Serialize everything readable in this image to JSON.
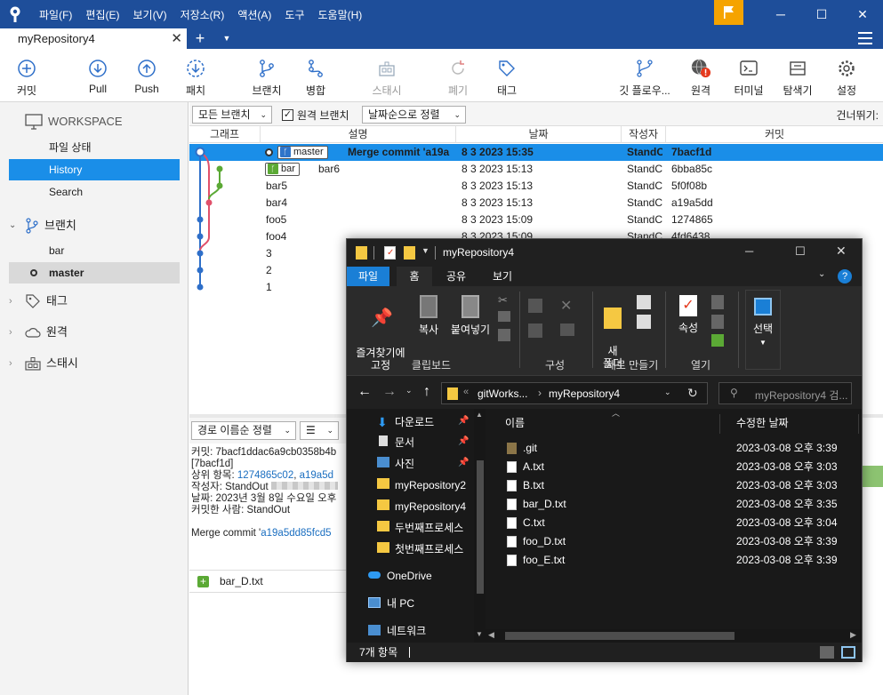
{
  "titlebar": {
    "menu": [
      "파일(F)",
      "편집(E)",
      "보기(V)",
      "저장소(R)",
      "액션(A)",
      "도구",
      "도움말(H)"
    ],
    "minimize": "─",
    "maximize": "☐",
    "close": "✕"
  },
  "tabbar": {
    "tab_title": "myRepository4",
    "close": "✕",
    "plus": "+",
    "dropdown": "▼"
  },
  "toolbar": {
    "commit": "커밋",
    "pull": "Pull",
    "push": "Push",
    "fetch": "패치",
    "branch": "브랜치",
    "merge": "병합",
    "stash": "스태시",
    "discard": "폐기",
    "tag": "태그",
    "gitflow": "깃 플로우...",
    "remote": "원격",
    "terminal": "터미널",
    "explorer": "탐색기",
    "settings": "설정"
  },
  "sidebar": {
    "workspace": "WORKSPACE",
    "file_status": "파일 상태",
    "history": "History",
    "search": "Search",
    "branches_header": "브랜치",
    "branch_bar": "bar",
    "branch_master": "master",
    "tags": "태그",
    "remotes": "원격",
    "stashes": "스태시"
  },
  "filterbar": {
    "all_branches": "모든 브랜치",
    "remote_branches": "원격 브랜치",
    "remote_checked": true,
    "sort": "날짜순으로 정렬",
    "skip": "건너뛰기:"
  },
  "columns": {
    "graph": "그래프",
    "description": "설명",
    "date": "날짜",
    "author": "작성자",
    "commit": "커밋"
  },
  "commits": [
    {
      "tag": "master",
      "desc": "Merge commit 'a19a",
      "date": "8 3 2023 15:35",
      "author": "StandC",
      "hash": "7bacf1d"
    },
    {
      "tag": "bar",
      "desc": "bar6",
      "date": "8 3 2023 15:13",
      "author": "StandC",
      "hash": "6bba85c"
    },
    {
      "tag": "",
      "desc": "bar5",
      "date": "8 3 2023 15:13",
      "author": "StandC",
      "hash": "5f0f08b"
    },
    {
      "tag": "",
      "desc": "bar4",
      "date": "8 3 2023 15:13",
      "author": "StandC",
      "hash": "a19a5dd"
    },
    {
      "tag": "",
      "desc": "foo5",
      "date": "8 3 2023 15:09",
      "author": "StandC",
      "hash": "1274865"
    },
    {
      "tag": "",
      "desc": "foo4",
      "date": "8 3 2023 15:09",
      "author": "StandC",
      "hash": "4fd6438"
    },
    {
      "tag": "",
      "desc": "3",
      "date": "",
      "author": "",
      "hash": ""
    },
    {
      "tag": "",
      "desc": "2",
      "date": "",
      "author": "",
      "hash": ""
    },
    {
      "tag": "",
      "desc": "1",
      "date": "",
      "author": "",
      "hash": ""
    }
  ],
  "lower": {
    "sort_paths": "경로 이름순 정렬",
    "view_menu": "☰",
    "commit_line": "커밋: 7bacf1ddac6a9cb0358b4b",
    "commit_short": "[7bacf1d]",
    "parents_label": "상위 항목: ",
    "parent1": "1274865c02",
    "parent_sep": ", ",
    "parent2": "a19a5d",
    "author_line": "작성자: StandOut",
    "date_line": "날짜: 2023년 3월 8일 수요일 오후",
    "committer_line": "커밋한 사람: StandOut",
    "message_prefix": "Merge commit '",
    "message_link": "a19a5dd85fcd5",
    "file": "bar_D.txt"
  },
  "explorer": {
    "title": "myRepository4",
    "tabs": [
      "파일",
      "홈",
      "공유",
      "보기"
    ],
    "ribbon": {
      "pin": "즐겨찾기에\n고정",
      "copy": "복사",
      "paste": "붙여넣기",
      "new_folder": "새\n폴더",
      "properties": "속성",
      "select": "선택",
      "group_clipboard": "클립보드",
      "group_organize": "구성",
      "group_new": "새로 만들기",
      "group_open": "열기"
    },
    "address": {
      "crumb1": "gitWorks...",
      "crumb2": "myRepository4",
      "search_placeholder": "myRepository4 검..."
    },
    "nav": [
      "다운로드",
      "문서",
      "사진",
      "myRepository2",
      "myRepository4",
      "두번째프로세스",
      "첫번째프로세스",
      "OneDrive",
      "내 PC",
      "네트워크"
    ],
    "columns": {
      "name": "이름",
      "modified": "수정한 날짜"
    },
    "files": [
      {
        "name": ".git",
        "date": "2023-03-08 오후 3:39",
        "type": "folder"
      },
      {
        "name": "A.txt",
        "date": "2023-03-08 오후 3:03",
        "type": "file"
      },
      {
        "name": "B.txt",
        "date": "2023-03-08 오후 3:03",
        "type": "file"
      },
      {
        "name": "bar_D.txt",
        "date": "2023-03-08 오후 3:35",
        "type": "file"
      },
      {
        "name": "C.txt",
        "date": "2023-03-08 오후 3:04",
        "type": "file"
      },
      {
        "name": "foo_D.txt",
        "date": "2023-03-08 오후 3:39",
        "type": "file"
      },
      {
        "name": "foo_E.txt",
        "date": "2023-03-08 오후 3:39",
        "type": "file"
      }
    ],
    "status": "7개 항목"
  }
}
